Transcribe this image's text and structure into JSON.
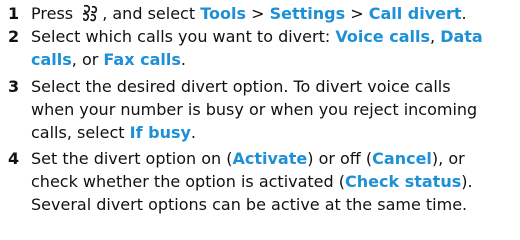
{
  "colors": {
    "keyword": "#1e90d6",
    "text": "#111111"
  },
  "steps": [
    {
      "number": "1",
      "icon": "menu-key-icon",
      "t1": "Press",
      "t2": ", and select",
      "kw_tools": "Tools",
      "sep1": ">",
      "kw_settings": "Settings",
      "sep2": ">",
      "kw_call_divert": "Call divert",
      "end": "."
    },
    {
      "number": "2",
      "t1": "Select which calls you want to divert:",
      "kw_voice": "Voice calls",
      "c1": ",",
      "kw_data_a": "Data",
      "kw_data_b": "calls",
      "c2": ", or",
      "kw_fax": "Fax calls",
      "end": "."
    },
    {
      "number": "3",
      "l1": "Select the desired divert option. To divert voice calls",
      "l2": "when your number is busy or when you reject incoming",
      "l3": "calls, select",
      "kw_if_busy": "If busy",
      "end": "."
    },
    {
      "number": "4",
      "l1a": "Set the divert option on (",
      "kw_activate": "Activate",
      "l1b": ") or off (",
      "kw_cancel": "Cancel",
      "l1c": "), or",
      "l2a": "check whether the option is activated (",
      "kw_check_status": "Check status",
      "l2b": ").",
      "l3": "Several divert options can be active at the same time."
    }
  ]
}
